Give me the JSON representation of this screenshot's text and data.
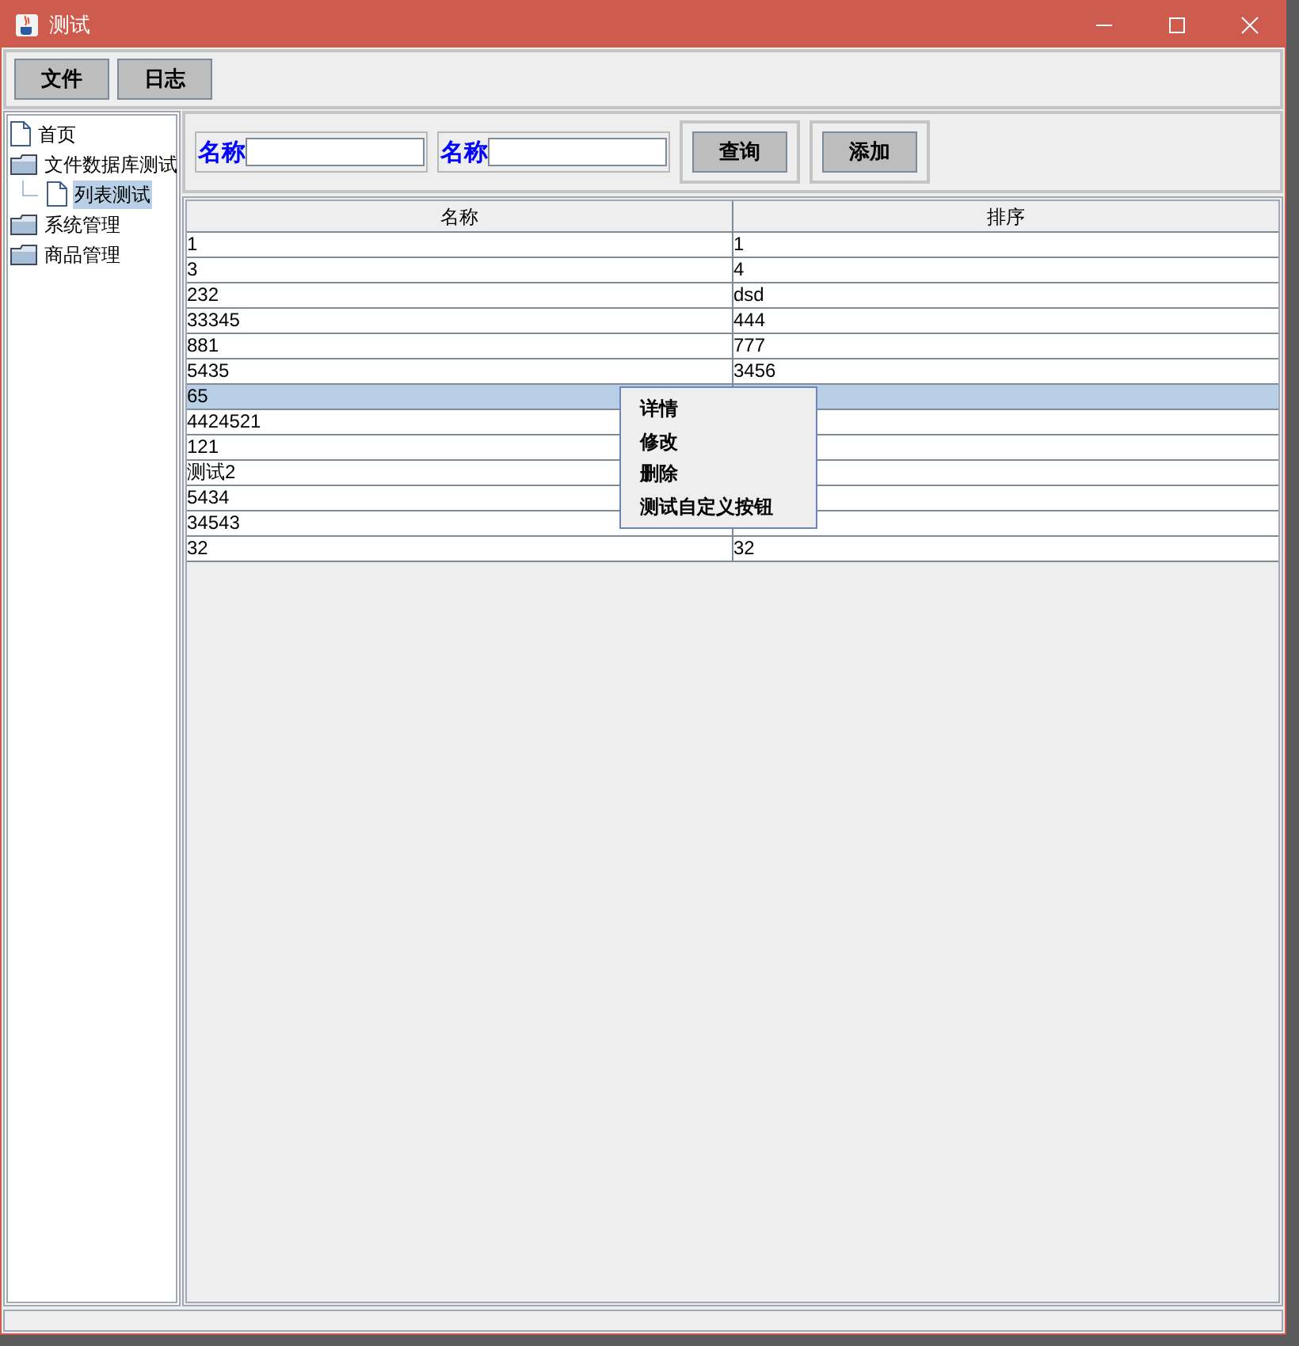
{
  "window": {
    "title": "测试"
  },
  "toolbar": [
    "文件",
    "日志"
  ],
  "tree": [
    {
      "label": "首页",
      "kind": "leaf",
      "selected": false
    },
    {
      "label": "文件数据库测试",
      "kind": "folder",
      "selected": false,
      "children": [
        {
          "label": "列表测试",
          "kind": "leaf",
          "selected": true
        }
      ]
    },
    {
      "label": "系统管理",
      "kind": "folder",
      "selected": false
    },
    {
      "label": "商品管理",
      "kind": "folder",
      "selected": false
    }
  ],
  "search": {
    "fields": [
      {
        "label": "名称"
      },
      {
        "label": "名称"
      }
    ],
    "buttons": [
      "查询",
      "添加"
    ]
  },
  "table": {
    "columns": [
      "名称",
      "排序"
    ],
    "rows": [
      {
        "cells": [
          "1",
          "1"
        ],
        "selected": false
      },
      {
        "cells": [
          "3",
          "4"
        ],
        "selected": false
      },
      {
        "cells": [
          "232",
          "dsd"
        ],
        "selected": false
      },
      {
        "cells": [
          "33345",
          "444"
        ],
        "selected": false
      },
      {
        "cells": [
          "881",
          "777"
        ],
        "selected": false
      },
      {
        "cells": [
          "5435",
          "3456"
        ],
        "selected": false
      },
      {
        "cells": [
          "65"
        ],
        "selected": true
      },
      {
        "cells": [
          "4424521"
        ],
        "selected": false
      },
      {
        "cells": [
          "121"
        ],
        "selected": false
      },
      {
        "cells": [
          "测试2"
        ],
        "selected": false
      },
      {
        "cells": [
          "5434"
        ],
        "selected": false
      },
      {
        "cells": [
          "34543"
        ],
        "selected": false
      },
      {
        "cells": [
          "32",
          "32"
        ],
        "selected": false
      }
    ]
  },
  "context_menu": [
    "详情",
    "修改",
    "删除",
    "测试自定义按钮"
  ]
}
